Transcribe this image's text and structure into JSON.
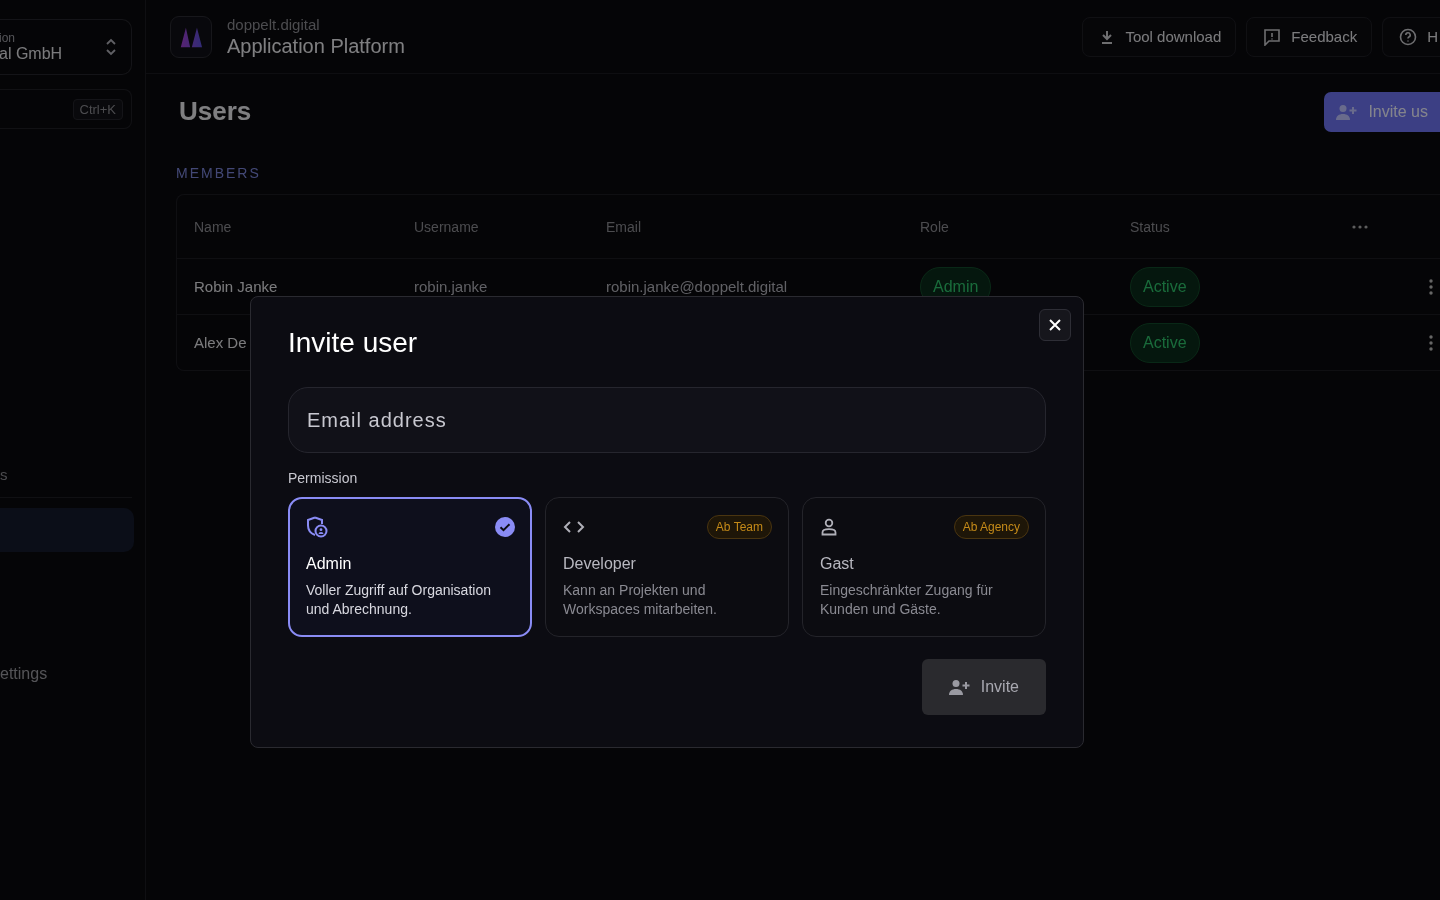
{
  "sidebar": {
    "org_selector": {
      "label": "ion",
      "value": "al GmbH"
    },
    "search": {
      "shortcut": "Ctrl+K"
    },
    "items": [
      {
        "label": "s",
        "kind": "section"
      },
      {
        "kind": "item",
        "selected": true
      },
      {
        "label": "ettings",
        "kind": "item",
        "selected": false
      }
    ]
  },
  "header": {
    "brand": "doppelt.digital",
    "title": "Application Platform",
    "buttons": [
      {
        "label": "Tool download"
      },
      {
        "label": "Feedback"
      },
      {
        "label": "H"
      }
    ]
  },
  "page": {
    "title": "Users",
    "primary_button": "Invite us",
    "section": "MEMBERS"
  },
  "table": {
    "columns": [
      "Name",
      "Username",
      "Email",
      "Role",
      "Status"
    ],
    "rows": [
      {
        "name": "Robin Janke",
        "username": "robin.janke",
        "email": "robin.janke@doppelt.digital",
        "role": "Admin",
        "status": "Active"
      },
      {
        "name": "Alex De",
        "status": "Active"
      }
    ]
  },
  "dialog": {
    "title": "Invite user",
    "email": {
      "placeholder": "Email address"
    },
    "permission_label": "Permission",
    "roles": [
      {
        "kind": "admin",
        "name": "Admin",
        "description": "Voller Zugriff auf Organisation und Abrechnung.",
        "selected": true
      },
      {
        "kind": "developer",
        "name": "Developer",
        "description": "Kann an Projekten und Workspaces mitarbeiten.",
        "badge": "Ab Team",
        "selected": false
      },
      {
        "kind": "guest",
        "name": "Gast",
        "description": "Eingeschränkter Zugang für Kunden und Gäste.",
        "badge": "Ab Agency",
        "selected": false
      }
    ],
    "submit": "Invite"
  }
}
